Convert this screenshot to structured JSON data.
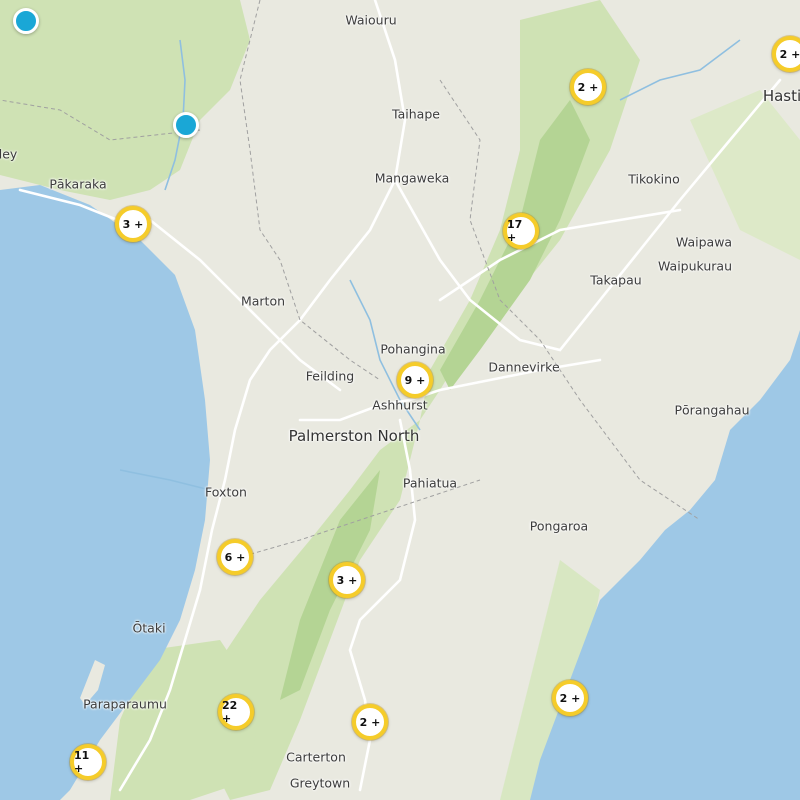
{
  "places": [
    {
      "id": "waiouru",
      "label": "Waiouru"
    },
    {
      "id": "taihape",
      "label": "Taihape"
    },
    {
      "id": "mangaweka",
      "label": "Mangaweka"
    },
    {
      "id": "pakaraka",
      "label": "Pākaraka"
    },
    {
      "id": "ley",
      "label": "ley"
    },
    {
      "id": "tikokino",
      "label": "Tikokino"
    },
    {
      "id": "waipawa",
      "label": "Waipawa"
    },
    {
      "id": "waipukurau",
      "label": "Waipukurau"
    },
    {
      "id": "takapau",
      "label": "Takapau"
    },
    {
      "id": "hasti",
      "label": "Hasti"
    },
    {
      "id": "marton",
      "label": "Marton"
    },
    {
      "id": "pohangina",
      "label": "Pohangina"
    },
    {
      "id": "dannevirke",
      "label": "Dannevirke"
    },
    {
      "id": "feilding",
      "label": "Feilding"
    },
    {
      "id": "ashhurst",
      "label": "Ashhurst"
    },
    {
      "id": "palmerston-north",
      "label": "Palmerston North"
    },
    {
      "id": "porangahau",
      "label": "Pōrangahau"
    },
    {
      "id": "foxton",
      "label": "Foxton"
    },
    {
      "id": "pahiatua",
      "label": "Pahiatua"
    },
    {
      "id": "pongaroa",
      "label": "Pongaroa"
    },
    {
      "id": "otaki",
      "label": "Ōtaki"
    },
    {
      "id": "paraparaumu",
      "label": "Paraparaumu"
    },
    {
      "id": "carterton",
      "label": "Carterton"
    },
    {
      "id": "greytown",
      "label": "Greytown"
    }
  ],
  "clusters": [
    {
      "id": "hawkes-bay-north",
      "label": "2 +"
    },
    {
      "id": "hastings",
      "label": "2 +"
    },
    {
      "id": "whanganui",
      "label": "3 +"
    },
    {
      "id": "ruahine",
      "label": "17 +"
    },
    {
      "id": "ashhurst",
      "label": "9 +"
    },
    {
      "id": "levin",
      "label": "6 +"
    },
    {
      "id": "eketahuna",
      "label": "3 +"
    },
    {
      "id": "coast",
      "label": "2 +"
    },
    {
      "id": "tararua",
      "label": "22 +"
    },
    {
      "id": "carterton",
      "label": "2 +"
    },
    {
      "id": "kapiti",
      "label": "11 +"
    }
  ],
  "markers": [
    {
      "id": "marker-1"
    },
    {
      "id": "marker-2"
    }
  ],
  "colors": {
    "land": "#e9e9e0",
    "water": "#9ec8e6",
    "forest": "#c9dfae",
    "forest_dark": "#a9cd8a",
    "road": "#ffffff",
    "border": "#9a9a9a",
    "cluster_ring": "#f5cc2a",
    "marker": "#1aa7d6"
  }
}
